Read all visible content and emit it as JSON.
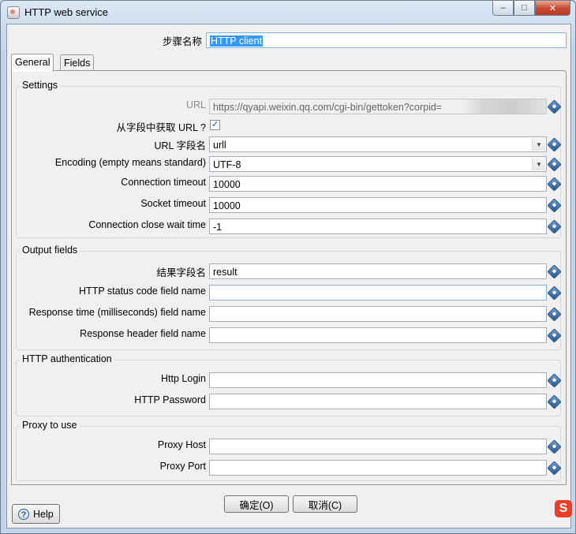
{
  "window": {
    "title": "HTTP web service",
    "controls": {
      "minimize": "–",
      "maximize": "□",
      "close": "✕"
    }
  },
  "step_name": {
    "label": "步骤名称",
    "value": "HTTP client"
  },
  "tabs": [
    {
      "label": "General"
    },
    {
      "label": "Fields"
    }
  ],
  "settings": {
    "title": "Settings",
    "url": {
      "label": "URL",
      "value": "https://qyapi.weixin.qq.com/cgi-bin/gettoken?corpid="
    },
    "url_from_field": {
      "label": "从字段中获取 URL ?",
      "checked": true,
      "check_glyph": "✓"
    },
    "url_field_name": {
      "label": "URL 字段名",
      "value": "urll"
    },
    "encoding": {
      "label": "Encoding (empty means standard)",
      "value": "UTF-8"
    },
    "connection_timeout": {
      "label": "Connection timeout",
      "value": "10000"
    },
    "socket_timeout": {
      "label": "Socket timeout",
      "value": "10000"
    },
    "close_wait_time": {
      "label": "Connection close wait time",
      "value": "-1"
    }
  },
  "output_fields": {
    "title": "Output fields",
    "result_field": {
      "label": "结果字段名",
      "value": "result"
    },
    "status_code_field": {
      "label": "HTTP status code field name",
      "value": ""
    },
    "response_time_field": {
      "label": "Response time (milliseconds) field name",
      "value": ""
    },
    "response_header_field": {
      "label": "Response header field name",
      "value": ""
    }
  },
  "http_auth": {
    "title": "HTTP authentication",
    "login": {
      "label": "Http Login",
      "value": ""
    },
    "password": {
      "label": "HTTP Password",
      "value": ""
    }
  },
  "proxy": {
    "title": "Proxy to use",
    "host": {
      "label": "Proxy Host",
      "value": ""
    },
    "port": {
      "label": "Proxy Port",
      "value": ""
    }
  },
  "buttons": {
    "ok": "确定(O)",
    "cancel": "取消(C)",
    "help": "Help",
    "help_glyph": "?"
  },
  "dropdown_glyph": "▼",
  "tray_glyph": "S"
}
